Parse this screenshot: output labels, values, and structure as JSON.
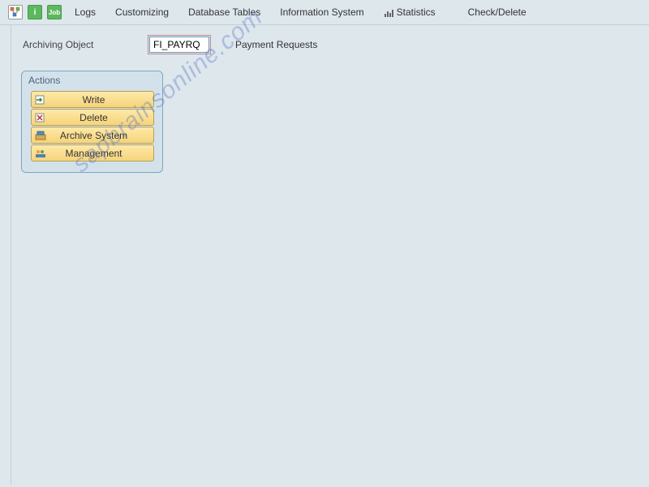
{
  "toolbar": {
    "items": [
      "Logs",
      "Customizing",
      "Database Tables",
      "Information System",
      "Statistics",
      "Check/Delete"
    ]
  },
  "object_row": {
    "label": "Archiving Object",
    "value": "FI_PAYRQ",
    "description": "Payment Requests"
  },
  "actions": {
    "title": "Actions",
    "buttons": [
      "Write",
      "Delete",
      "Archive System",
      "Management"
    ]
  },
  "watermark": "sapbrainsonline.com"
}
